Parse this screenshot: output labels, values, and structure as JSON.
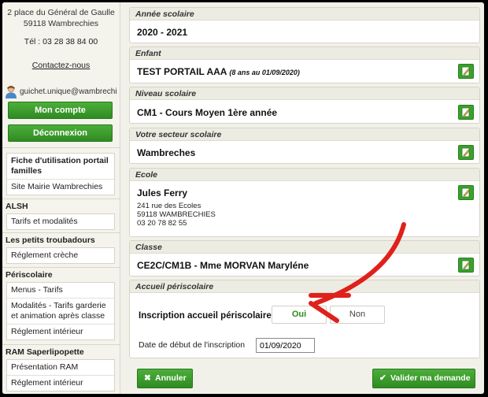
{
  "sidebar": {
    "address_line1": "2 place du Général de Gaulle",
    "address_line2": "59118 Wambrechies",
    "tel": "Tél : 03 28 38 84 00",
    "contact": "Contactez-nous",
    "user_email": "guichet.unique@wambrechi",
    "account_button": "Mon compte",
    "logout_button": "Déconnexion",
    "top_links": [
      "Fiche d'utilisation portail familles",
      "Site Mairie Wambrechies"
    ],
    "groups": [
      {
        "title": "ALSH",
        "links": [
          "Tarifs et modalités"
        ]
      },
      {
        "title": "Les petits troubadours",
        "links": [
          "Réglement crèche"
        ]
      },
      {
        "title": "Périscolaire",
        "links": [
          "Menus - Tarifs",
          "Modalités - Tarifs garderie et animation après classe",
          "Réglement intérieur"
        ]
      },
      {
        "title": "RAM Saperlipopette",
        "links": [
          "Présentation RAM",
          "Réglement intérieur"
        ]
      }
    ]
  },
  "main": {
    "annee": {
      "header": "Année scolaire",
      "value": "2020 - 2021"
    },
    "enfant": {
      "header": "Enfant",
      "value": "TEST PORTAIL AAA",
      "detail": "(8 ans au 01/09/2020)"
    },
    "niveau": {
      "header": "Niveau scolaire",
      "value": "CM1 - Cours Moyen 1ère année"
    },
    "secteur": {
      "header": "Votre secteur scolaire",
      "value": "Wambreches"
    },
    "ecole": {
      "header": "Ecole",
      "value": "Jules Ferry",
      "addr1": "241 rue des Ecoles",
      "addr2": "59118 WAMBRECHIES",
      "phone": "03 20 78 82 55"
    },
    "classe": {
      "header": "Classe",
      "value": "CE2C/CM1B - Mme MORVAN Maryléne"
    },
    "accueil": {
      "header": "Accueil périscolaire",
      "label": "Inscription accueil périscolaire",
      "yes": "Oui",
      "no": "Non",
      "date_label": "Date de début de l'inscription",
      "date_value": "01/09/2020"
    },
    "cancel_button": "Annuler",
    "submit_button": "Valider ma demande"
  },
  "colors": {
    "accent_green": "#3aa12d",
    "annotation_red": "#e0201b"
  },
  "icons": [
    "user-icon",
    "edit-icon",
    "close-icon",
    "check-icon"
  ]
}
